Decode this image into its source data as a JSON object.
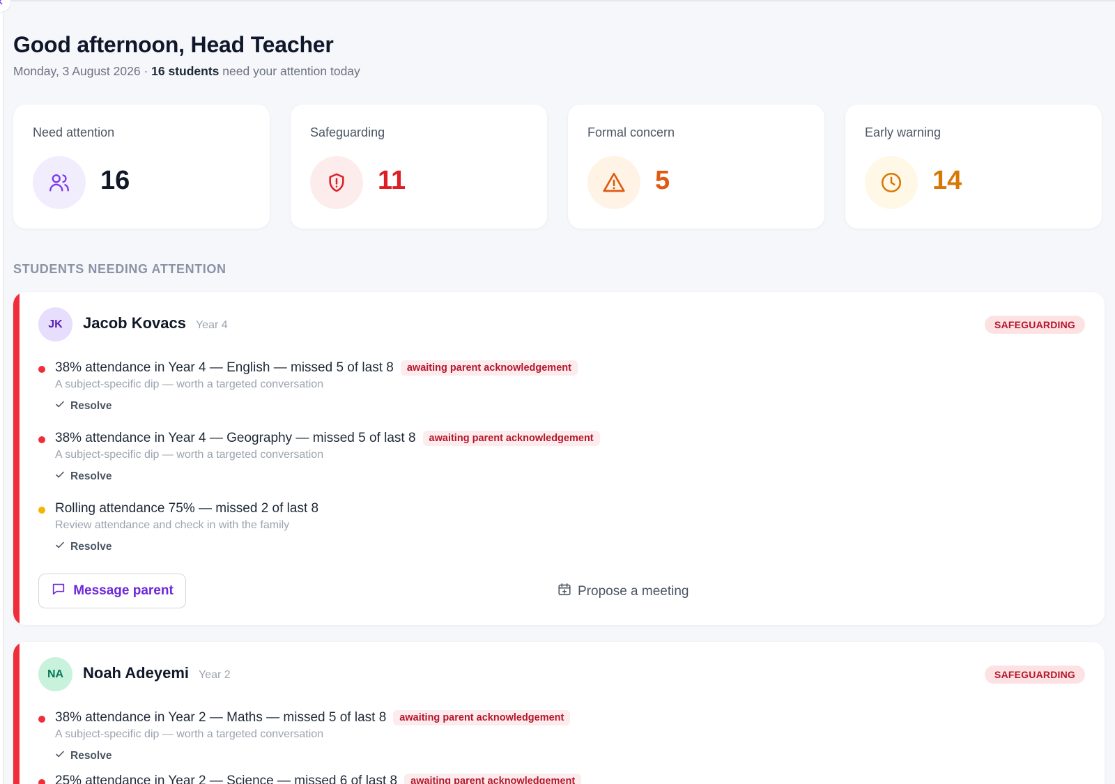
{
  "header": {
    "greeting": "Good afternoon, Head Teacher",
    "date": "Monday, 3 August 2026",
    "separator": " · ",
    "count_text": "16 students",
    "suffix": "need your attention today"
  },
  "stats": [
    {
      "label": "Need attention",
      "value": "16",
      "icon": "users-icon",
      "color": "#111827",
      "icon_color": "#7c3aed",
      "icon_bg": "#f1edfd"
    },
    {
      "label": "Safeguarding",
      "value": "11",
      "icon": "shield-alert-icon",
      "color": "#dc1f26",
      "icon_color": "#dc1f26",
      "icon_bg": "#fdecec"
    },
    {
      "label": "Formal concern",
      "value": "5",
      "icon": "warning-triangle-icon",
      "color": "#e05a12",
      "icon_color": "#e05a12",
      "icon_bg": "#fff3e6"
    },
    {
      "label": "Early warning",
      "value": "14",
      "icon": "clock-icon",
      "color": "#d97706",
      "icon_color": "#d97706",
      "icon_bg": "#fff8e6"
    }
  ],
  "section_title": "STUDENTS NEEDING ATTENTION",
  "students": [
    {
      "initials": "JK",
      "name": "Jacob Kovacs",
      "year": "Year 4",
      "badge": "SAFEGUARDING",
      "avatar_bg": "#e6defc",
      "avatar_color": "#5b21b6",
      "issues": [
        {
          "text": "38% attendance in Year 4 — English — missed 5 of last 8",
          "pill": "awaiting parent acknowledgement",
          "desc": "A subject-specific dip — worth a targeted conversation",
          "resolve": "Resolve",
          "dot": "#ef2d3b"
        },
        {
          "text": "38% attendance in Year 4 — Geography — missed 5 of last 8",
          "pill": "awaiting parent acknowledgement",
          "desc": "A subject-specific dip — worth a targeted conversation",
          "resolve": "Resolve",
          "dot": "#ef2d3b"
        },
        {
          "text": "Rolling attendance 75% — missed 2 of last 8",
          "pill": "",
          "desc": "Review attendance and check in with the family",
          "resolve": "Resolve",
          "dot": "#f5b400"
        }
      ],
      "message_label": "Message parent",
      "meeting_label": "Propose a meeting"
    },
    {
      "initials": "NA",
      "name": "Noah Adeyemi",
      "year": "Year 2",
      "badge": "SAFEGUARDING",
      "avatar_bg": "#c8f2dc",
      "avatar_color": "#047857",
      "issues": [
        {
          "text": "38% attendance in Year 2 — Maths — missed 5 of last 8",
          "pill": "awaiting parent acknowledgement",
          "desc": "A subject-specific dip — worth a targeted conversation",
          "resolve": "Resolve",
          "dot": "#ef2d3b"
        },
        {
          "text": "25% attendance in Year 2 — Science — missed 6 of last 8",
          "pill": "awaiting parent acknowledgement",
          "desc": "",
          "resolve": "",
          "dot": "#ef2d3b"
        }
      ]
    }
  ]
}
